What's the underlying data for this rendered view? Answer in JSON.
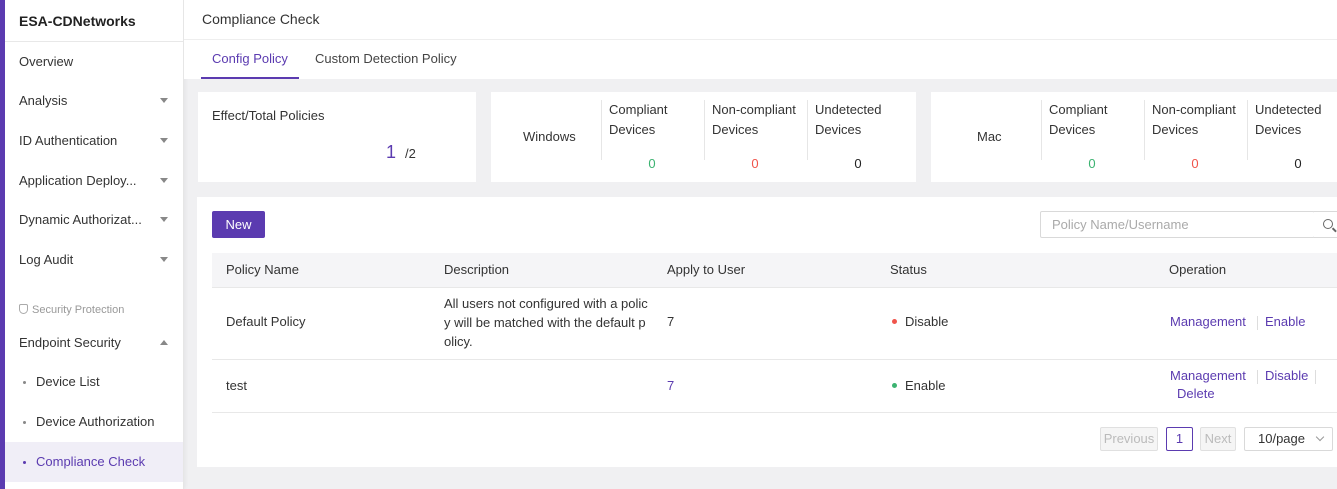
{
  "sidebar": {
    "brand": "ESA-CDNetworks",
    "items": [
      {
        "label": "Overview"
      },
      {
        "label": "Analysis"
      },
      {
        "label": "ID Authentication"
      },
      {
        "label": "Application Deploy..."
      },
      {
        "label": "Dynamic Authorizat..."
      },
      {
        "label": "Log Audit"
      }
    ],
    "group_label": "Security Protection",
    "endpoint": {
      "label": "Endpoint Security"
    },
    "sub_items": [
      {
        "label": "Device List"
      },
      {
        "label": "Device Authorization"
      },
      {
        "label": "Compliance Check"
      }
    ]
  },
  "header": {
    "title": "Compliance Check"
  },
  "tabs": [
    {
      "label": "Config Policy"
    },
    {
      "label": "Custom Detection Policy"
    }
  ],
  "summary": {
    "title": "Effect/Total Policies",
    "effect": "1",
    "total": "/2"
  },
  "stats": {
    "col_compliant": [
      "Compliant",
      "Devices"
    ],
    "col_noncompliant": [
      "Non-compliant",
      "Devices"
    ],
    "col_undetected": [
      "Undetected",
      "Devices"
    ],
    "windows": {
      "label": "Windows",
      "compliant": "0",
      "noncompliant": "0",
      "undetected": "0"
    },
    "mac": {
      "label": "Mac",
      "compliant": "0",
      "noncompliant": "0",
      "undetected": "0"
    }
  },
  "toolbar": {
    "new_label": "New",
    "search_placeholder": "Policy Name/Username"
  },
  "table": {
    "columns": [
      "Policy Name",
      "Description",
      "Apply to User",
      "Status",
      "Operation"
    ],
    "rows": [
      {
        "name": "Default Policy",
        "description_lines": [
          "All users not configured with a polic",
          "y will be matched with the default p",
          "olicy."
        ],
        "apply_to_user": "7",
        "status": "Disable",
        "ops": [
          "Management",
          "Enable"
        ]
      },
      {
        "name": "test",
        "description_lines": [],
        "apply_to_user": "7",
        "status": "Enable",
        "ops": [
          "Management",
          "Disable",
          "Delete"
        ]
      }
    ]
  },
  "pagination": {
    "prev": "Previous",
    "page": "1",
    "next": "Next",
    "page_size": "10/page"
  },
  "colors": {
    "accent": "#5b3bb0",
    "compliant": "#3cb371",
    "noncompliant": "#f0544b",
    "status_disable": "#f0544b",
    "status_enable": "#3cb371"
  }
}
